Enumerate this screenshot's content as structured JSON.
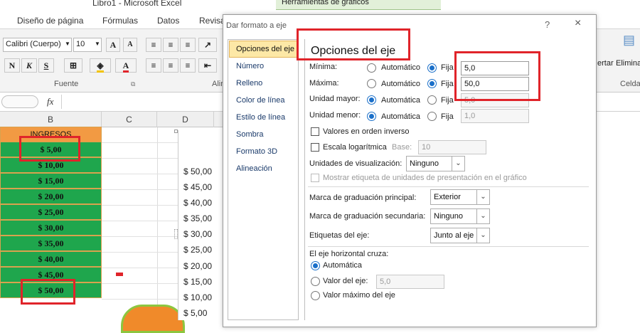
{
  "app": {
    "title": "Libro1 - Microsoft Excel",
    "context_tab": "Herramientas de gráficos"
  },
  "ribbon_tabs": [
    "Diseño de página",
    "Fórmulas",
    "Datos",
    "Revisa"
  ],
  "ribbon": {
    "font_name": "Calibri (Cuerpo)",
    "font_size": "10",
    "bold": "N",
    "italic": "K",
    "underline": "S",
    "grow": "A",
    "shrink": "A",
    "font_group_label": "Fuente",
    "align_group_label": "Alin",
    "insert_label": "ertar",
    "delete_label": "Elimina",
    "cells_label": "Celda"
  },
  "formula_bar": {
    "fx": "fx"
  },
  "grid": {
    "columns": [
      "B",
      "C",
      "D"
    ],
    "header": "INGRESOS",
    "values": [
      "$ 5,00",
      "$ 10,00",
      "$ 15,00",
      "$ 20,00",
      "$ 25,00",
      "$ 30,00",
      "$ 35,00",
      "$ 40,00",
      "$ 45,00",
      "$ 50,00"
    ]
  },
  "chart": {
    "y_ticks": [
      "$ 50,00",
      "$ 45,00",
      "$ 40,00",
      "$ 35,00",
      "$ 30,00",
      "$ 25,00",
      "$ 20,00",
      "$ 15,00",
      "$ 10,00",
      "$ 5,00"
    ]
  },
  "dialog": {
    "title": "Dar formato a eje",
    "help": "?",
    "close": "×",
    "nav": [
      "Opciones del eje",
      "Número",
      "Relleno",
      "Color de línea",
      "Estilo de línea",
      "Sombra",
      "Formato 3D",
      "Alineación"
    ],
    "panel_title": "Opciones del eje",
    "minimum": {
      "label": "Mínima:",
      "auto": "Automático",
      "fixed": "Fija",
      "value": "5,0"
    },
    "maximum": {
      "label": "Máxima:",
      "auto": "Automático",
      "fixed": "Fija",
      "value": "50,0"
    },
    "major_unit": {
      "label": "Unidad mayor:",
      "auto": "Automática",
      "fixed": "Fija",
      "value": "5,0"
    },
    "minor_unit": {
      "label": "Unidad menor:",
      "auto": "Automática",
      "fixed": "Fija",
      "value": "1,0"
    },
    "reverse_order": "Valores en orden inverso",
    "log_scale": "Escala logarítmica",
    "base_label": "Base:",
    "base_value": "10",
    "display_units_label": "Unidades de visualización:",
    "display_units_value": "Ninguno",
    "show_units_label": "Mostrar etiqueta de unidades de presentación en el gráfico",
    "major_tick_label": "Marca de graduación principal:",
    "major_tick_value": "Exterior",
    "minor_tick_label": "Marca de graduación secundaria:",
    "minor_tick_value": "Ninguno",
    "axis_labels_label": "Etiquetas del eje:",
    "axis_labels_value": "Junto al eje",
    "crosses_label": "El eje horizontal cruza:",
    "crosses_auto": "Automática",
    "crosses_value_label": "Valor del eje:",
    "crosses_value": "5,0",
    "crosses_max": "Valor máximo del eje"
  }
}
